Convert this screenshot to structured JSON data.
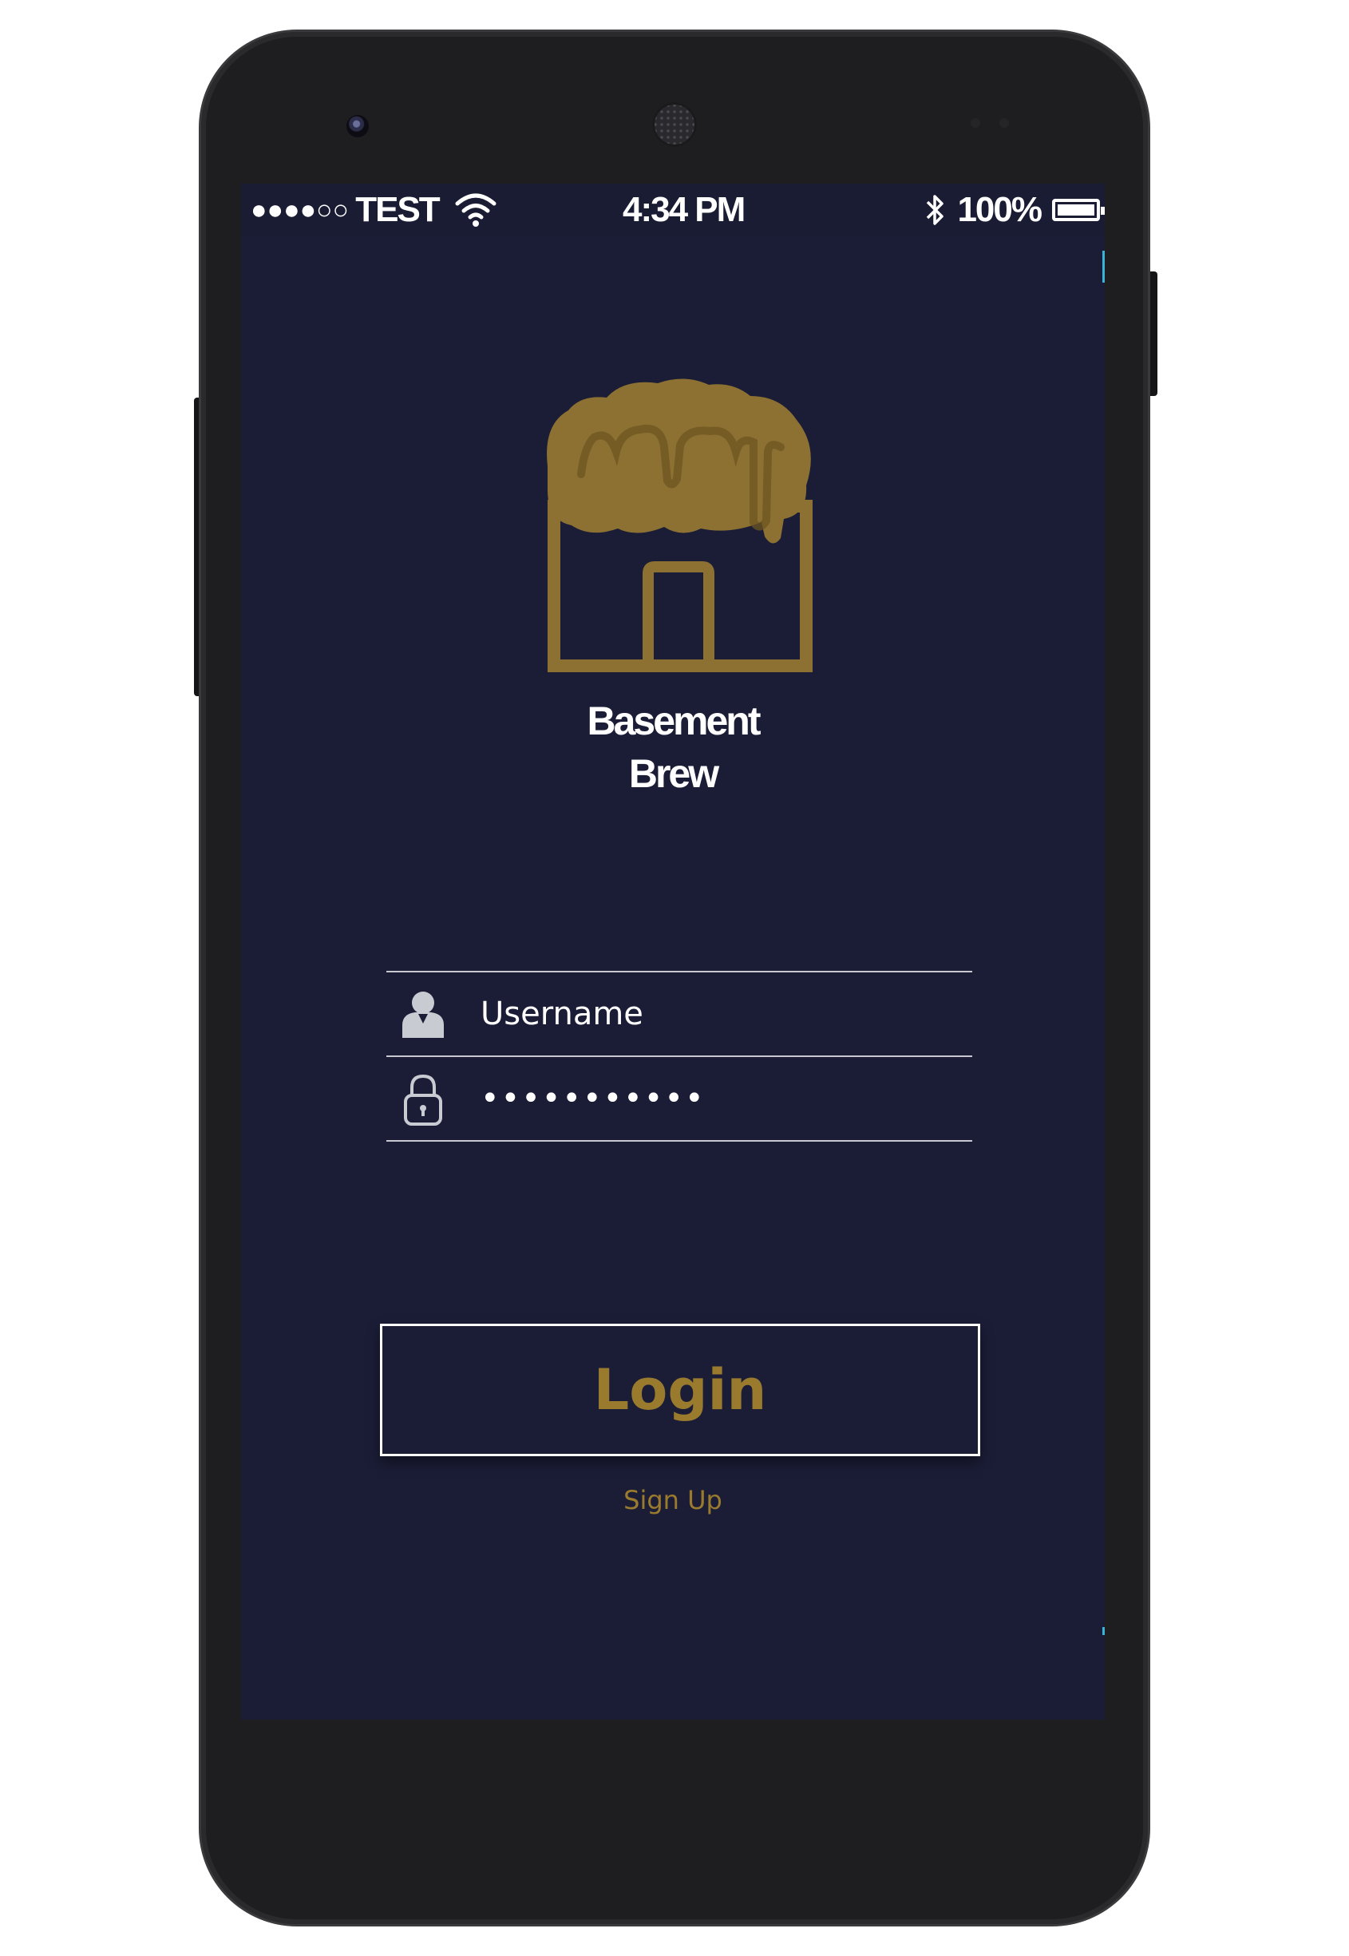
{
  "status_bar": {
    "signal": "●●●●○○",
    "carrier": "TEST",
    "time": "4:34 PM",
    "battery_text": "100%",
    "battery_level": 1.0
  },
  "brand": {
    "line1": "Basement",
    "line2": "Brew"
  },
  "form": {
    "username_placeholder": "Username",
    "password_value": "•••••••••••"
  },
  "actions": {
    "login_label": "Login",
    "signup_label": "Sign Up"
  },
  "colors": {
    "background": "#1b1d37",
    "accent": "#9a7b2e",
    "logo": "#8c7132"
  },
  "icons": {
    "username": "user-icon",
    "password": "lock-icon",
    "wifi": "wifi-icon",
    "bluetooth": "bluetooth-icon",
    "battery": "battery-icon"
  }
}
